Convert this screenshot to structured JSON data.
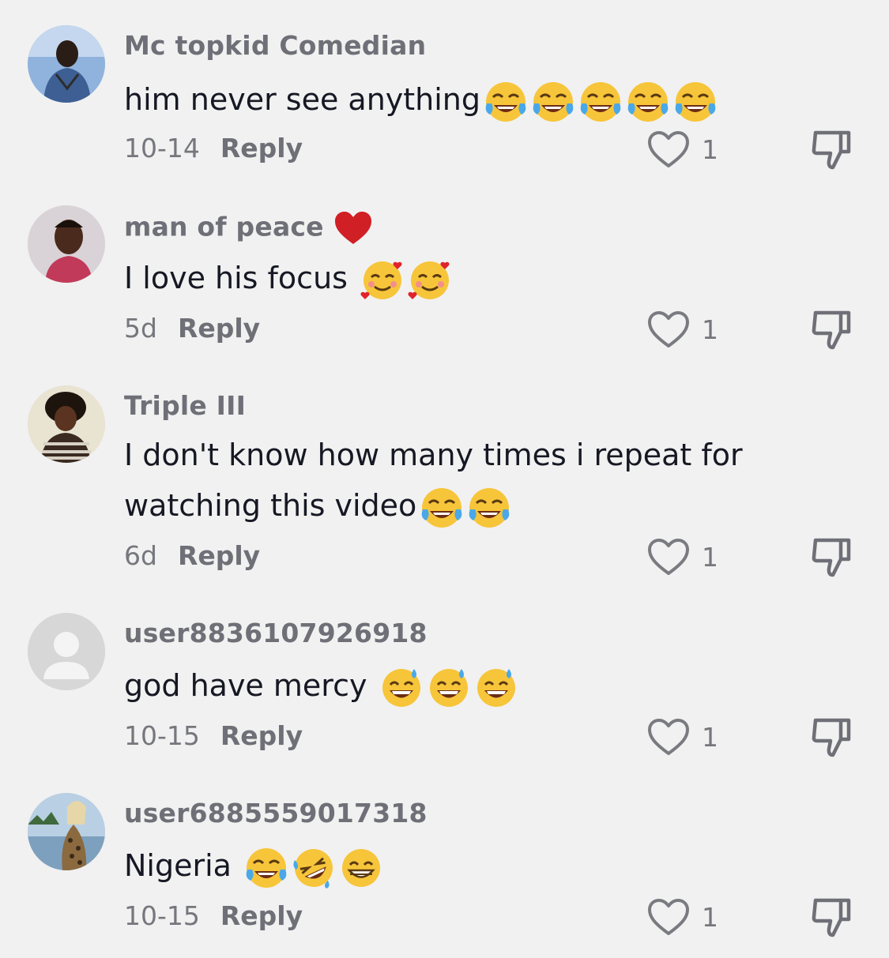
{
  "comments": [
    {
      "username": "Mc topkid Comedian",
      "text": "him never see anything",
      "emojis": [
        "face-with-tears-of-joy",
        "face-with-tears-of-joy",
        "face-with-tears-of-joy",
        "face-with-tears-of-joy",
        "face-with-tears-of-joy"
      ],
      "date": "10-14",
      "reply": "Reply",
      "likes": "1"
    },
    {
      "username": "man of peace",
      "username_emoji": "red-heart",
      "text": "I love his focus",
      "emojis": [
        "smiling-face-with-hearts",
        "smiling-face-with-hearts"
      ],
      "date": "5d",
      "reply": "Reply",
      "likes": "1"
    },
    {
      "username": "Triple III",
      "text_line1": "I don't know how many times i repeat for",
      "text_line2": "watching this video",
      "emojis": [
        "face-with-tears-of-joy",
        "face-with-tears-of-joy"
      ],
      "date": "6d",
      "reply": "Reply",
      "likes": "1"
    },
    {
      "username": "user8836107926918",
      "text": "god have mercy",
      "emojis": [
        "grinning-face-with-sweat",
        "grinning-face-with-sweat",
        "grinning-face-with-sweat"
      ],
      "date": "10-15",
      "reply": "Reply",
      "likes": "1"
    },
    {
      "username": "user6885559017318",
      "text": "Nigeria",
      "emojis": [
        "face-with-tears-of-joy",
        "rolling-on-the-floor-laughing",
        "beaming-face-with-smiling-eyes"
      ],
      "date": "10-15",
      "reply": "Reply",
      "likes": "1"
    }
  ],
  "colors": {
    "background": "#f1f1f1",
    "username": "#6f7077",
    "text": "#161823",
    "meta": "#76777d"
  }
}
